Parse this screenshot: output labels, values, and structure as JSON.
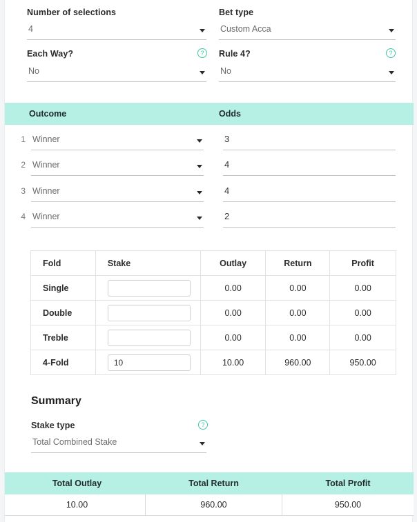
{
  "colors": {
    "teal_band": "#b6efe3",
    "accent": "#3fc8a8",
    "text": "#2b2b2b",
    "muted": "#6b6b6b",
    "border": "#e2e2e2"
  },
  "top_form": {
    "num_selections": {
      "label": "Number of selections",
      "value": "4",
      "caret": "chevron-down-icon"
    },
    "bet_type": {
      "label": "Bet type",
      "value": "Custom Acca",
      "caret": "chevron-down-icon"
    },
    "each_way": {
      "label": "Each Way?",
      "value": "No",
      "help": "?",
      "help_icon": "help-circle-icon"
    },
    "rule4": {
      "label": "Rule 4?",
      "value": "No",
      "help": "?",
      "help_icon": "help-circle-icon"
    }
  },
  "selections_header": {
    "outcome": "Outcome",
    "odds": "Odds"
  },
  "selections": [
    {
      "index": "1",
      "outcome": "Winner",
      "odds": "3"
    },
    {
      "index": "2",
      "outcome": "Winner",
      "odds": "4"
    },
    {
      "index": "3",
      "outcome": "Winner",
      "odds": "4"
    },
    {
      "index": "4",
      "outcome": "Winner",
      "odds": "2"
    }
  ],
  "fold_table": {
    "headers": {
      "fold": "Fold",
      "stake": "Stake",
      "outlay": "Outlay",
      "return": "Return",
      "profit": "Profit"
    },
    "rows": [
      {
        "fold": "Single",
        "stake": "",
        "stake_placeholder": "",
        "outlay": "0.00",
        "return": "0.00",
        "profit": "0.00"
      },
      {
        "fold": "Double",
        "stake": "",
        "stake_placeholder": "",
        "outlay": "0.00",
        "return": "0.00",
        "profit": "0.00"
      },
      {
        "fold": "Treble",
        "stake": "",
        "stake_placeholder": "",
        "outlay": "0.00",
        "return": "0.00",
        "profit": "0.00"
      },
      {
        "fold": "4-Fold",
        "stake": "10",
        "stake_placeholder": "",
        "outlay": "10.00",
        "return": "960.00",
        "profit": "950.00"
      }
    ]
  },
  "summary": {
    "title": "Summary",
    "stake_type": {
      "label": "Stake type",
      "value": "Total Combined Stake",
      "help": "?",
      "help_icon": "help-circle-icon",
      "caret": "chevron-down-icon"
    },
    "totals": {
      "headers": [
        "Total Outlay",
        "Total Return",
        "Total Profit"
      ],
      "values": [
        "10.00",
        "960.00",
        "950.00"
      ]
    }
  }
}
